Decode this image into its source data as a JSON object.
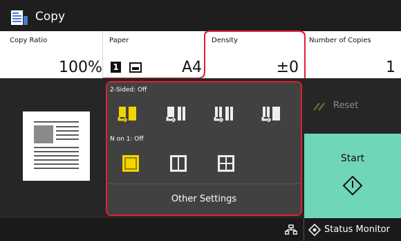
{
  "title_bar": {
    "title": "Copy",
    "icon": "copy-icon"
  },
  "settings": {
    "copy_ratio": {
      "label": "Copy Ratio",
      "value": "100%"
    },
    "paper": {
      "label": "Paper",
      "value": "A4",
      "drawer_number": "1",
      "icon": "paper-drawer-icon"
    },
    "density": {
      "label": "Density",
      "value": "±0"
    },
    "copies": {
      "label": "Number of Copies",
      "value": "1"
    }
  },
  "popup": {
    "two_sided_label": "2-Sided: Off",
    "two_sided_options": [
      "1-sided to 1-sided",
      "1-sided to 2-sided",
      "2-sided to 1-sided",
      "2-sided to 2-sided"
    ],
    "n_on_1_label": "N on 1: Off",
    "n_on_1_options": [
      "off",
      "2 on 1",
      "4 on 1"
    ],
    "other_settings_label": "Other Settings"
  },
  "reset_label": "Reset",
  "start_label": "Start",
  "status_monitor_label": "Status Monitor",
  "colors": {
    "accent_yellow": "#f2d400",
    "start_green": "#6fd7b7",
    "highlight_red": "#e0202e",
    "panel_dark": "#262626"
  }
}
